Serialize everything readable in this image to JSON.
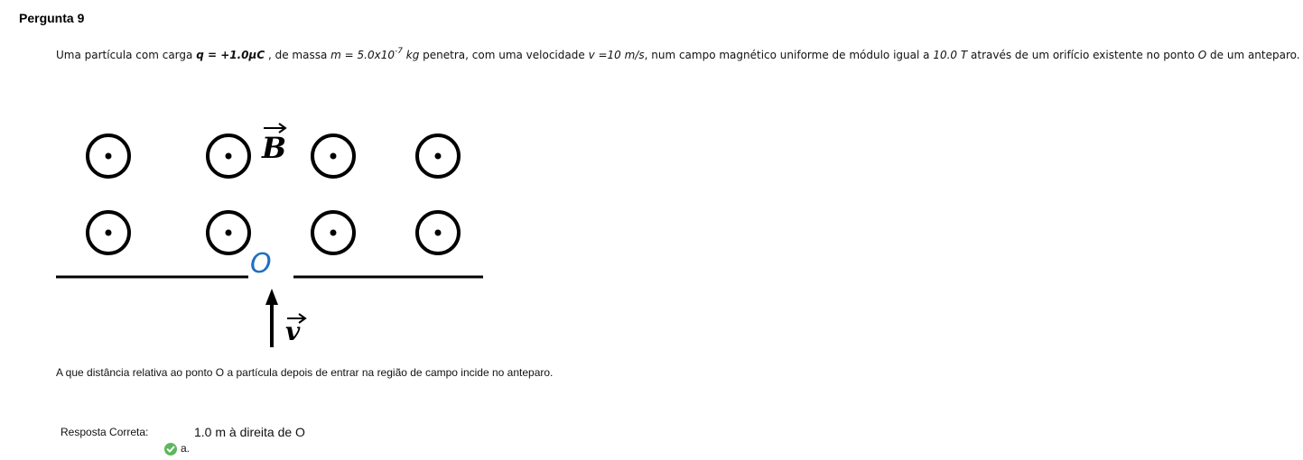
{
  "question": {
    "title": "Pergunta 9",
    "statement": {
      "p1": "Uma partícula com carga ",
      "q_expr": "q = +1.0μC",
      "p2": " , de massa ",
      "m_expr": "m = 5.0x10",
      "m_exp": "-7",
      "m_unit": " kg",
      "p3": "  penetra, com uma velocidade ",
      "v_expr": "v =10 m/s",
      "p4": ", num campo magnético uniforme de módulo igual a ",
      "b_expr": "10.0 T",
      "p5": " através  de um orifício existente no ponto  ",
      "o_expr": "O",
      "p6": " de um anteparo."
    },
    "figure": {
      "field_label": "B",
      "point_label": "O",
      "velocity_label": "v",
      "point_color": "#1f6fbf",
      "field_symbol": "out-of-page-circle-dot-icon",
      "field_rows": 2,
      "field_columns": 4
    },
    "prompt": "A que distância relativa ao ponto O a partícula depois de entrar na região de campo incide no anteparo."
  },
  "answer": {
    "label": "Resposta Correta:",
    "value": "1.0 m à direita de O",
    "option_letter": "a.",
    "check_icon": "check-circle-icon",
    "check_color": "#5cb85c"
  }
}
